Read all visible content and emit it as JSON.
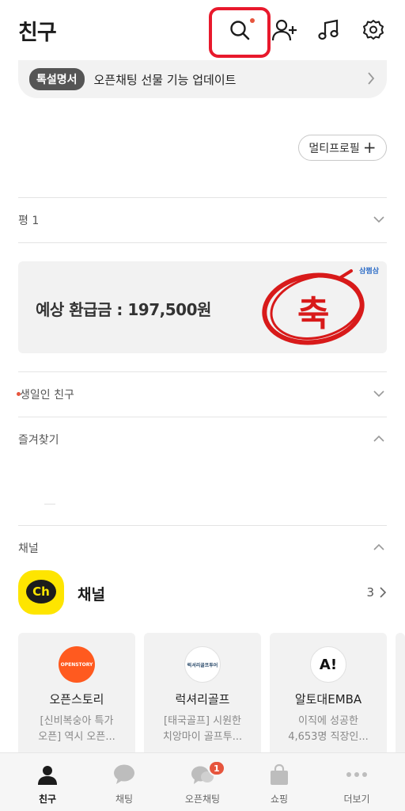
{
  "header": {
    "title": "친구",
    "icons": [
      "search-icon",
      "add-friend-icon",
      "music-icon",
      "settings-icon"
    ]
  },
  "notice": {
    "badge": "톡설명서",
    "text": "오픈채팅 선물 기능 업데이트"
  },
  "profile": {
    "multi_profile_label": "멀티프로필"
  },
  "sections": {
    "group_label": "평 1",
    "birthday_label": "생일인 친구",
    "favorites_label": "즐겨찾기",
    "channel_label": "채널"
  },
  "ad": {
    "refund_text": "예상 환급금 : 197,500원",
    "brand": "삼쩜삼",
    "stamp_char": "축"
  },
  "channel": {
    "title": "채널",
    "count": "3",
    "cards": [
      {
        "name": "오픈스토리",
        "desc_line1": "[신비복숭아 특가",
        "desc_line2": "오픈] 역시 오픈...",
        "logo_text": "OPENSTORY",
        "logo_color": "#ff5a1f"
      },
      {
        "name": "럭셔리골프",
        "desc_line1": "[태국골프] 시원한",
        "desc_line2": "치앙마이 골프투...",
        "logo_text": "럭셔리골프투어",
        "logo_color": "#ffffff"
      },
      {
        "name": "알토대EMBA",
        "desc_line1": "이직에 성공한",
        "desc_line2": "4,653명 직장인...",
        "logo_text": "A!",
        "logo_color": "#ffffff"
      }
    ]
  },
  "tabs": [
    {
      "label": "친구",
      "icon": "person-icon",
      "active": true
    },
    {
      "label": "채팅",
      "icon": "chat-bubble-icon"
    },
    {
      "label": "오픈채팅",
      "icon": "open-chat-icon",
      "badge": "1"
    },
    {
      "label": "쇼핑",
      "icon": "shopping-bag-icon"
    },
    {
      "label": "더보기",
      "icon": "more-dots-icon"
    }
  ],
  "colors": {
    "accent_badge": "#e6553d",
    "highlight_box": "#e8192c",
    "channel_yellow": "#fee500"
  }
}
